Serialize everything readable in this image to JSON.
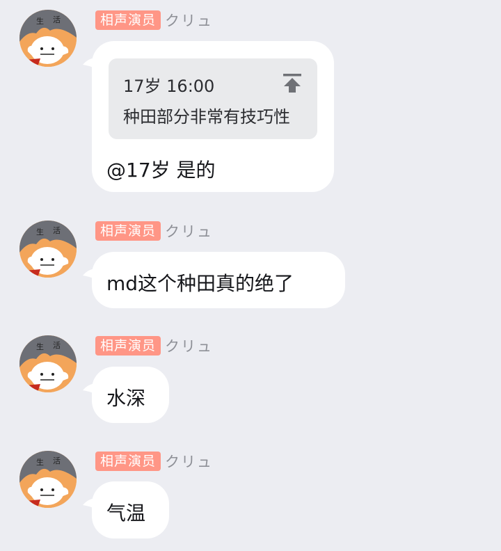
{
  "colors": {
    "background": "#ecedf2",
    "badge": "#ff9686",
    "bubble": "#ffffff",
    "quote_bg": "#e9eaec",
    "sender": "#8e9097"
  },
  "messages": [
    {
      "badge": "相声演员",
      "sender": "クリュ",
      "quote": {
        "meta": "17岁 16:00",
        "text": "种田部分非常有技巧性",
        "icon": "jump-to-top-icon"
      },
      "text": "@17岁 是的"
    },
    {
      "badge": "相声演员",
      "sender": "クリュ",
      "text": "md这个种田真的绝了"
    },
    {
      "badge": "相声演员",
      "sender": "クリュ",
      "text": "水深"
    },
    {
      "badge": "相声演员",
      "sender": "クリュ",
      "text": "气温"
    }
  ]
}
